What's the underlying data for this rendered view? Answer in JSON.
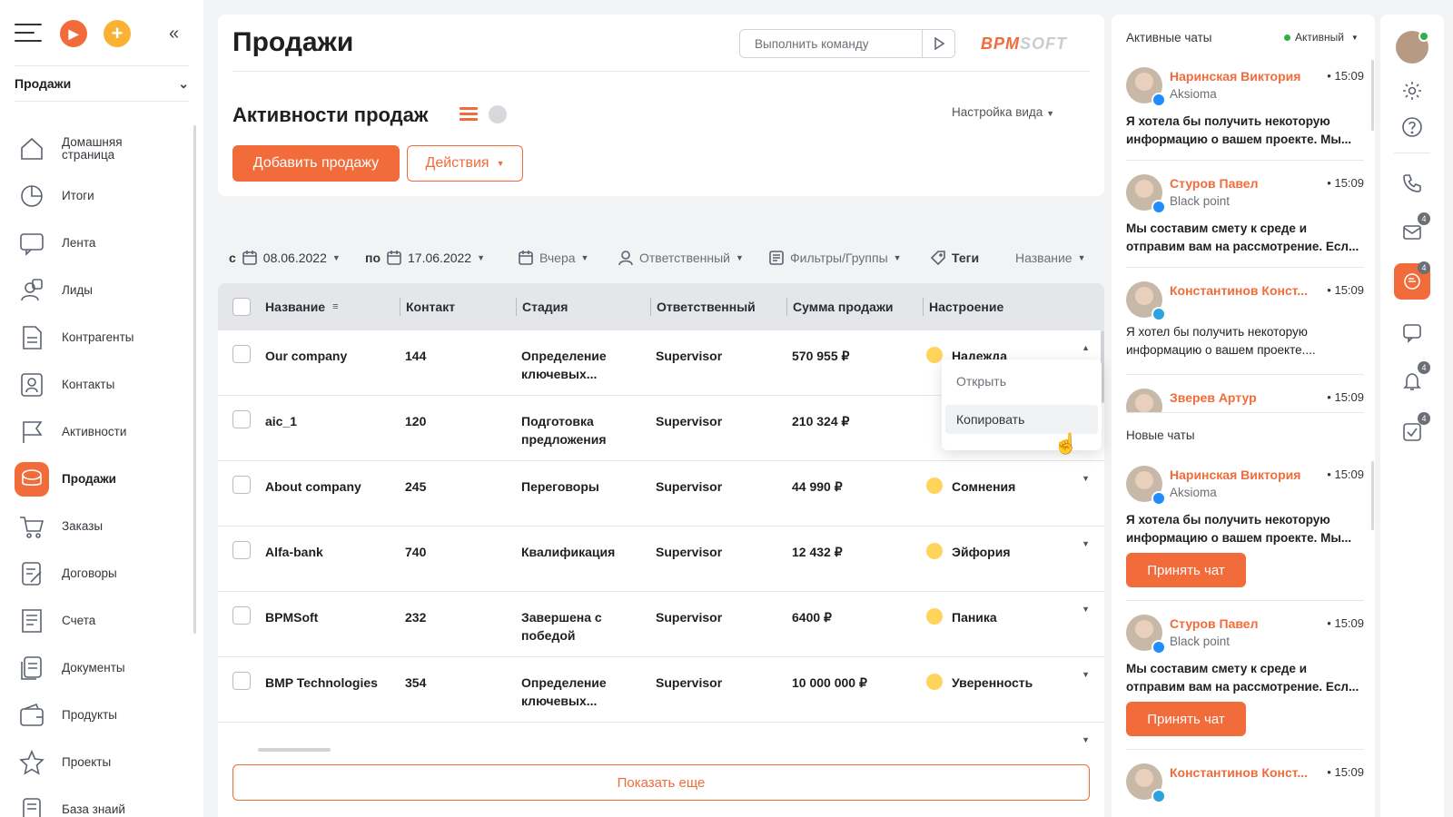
{
  "sidebar": {
    "section": "Продажи",
    "items": [
      {
        "label": "Домашняя страница",
        "icon": "home-icon"
      },
      {
        "label": "Итоги",
        "icon": "pie-chart-icon"
      },
      {
        "label": "Лента",
        "icon": "feed-icon"
      },
      {
        "label": "Лиды",
        "icon": "leads-icon"
      },
      {
        "label": "Контрагенты",
        "icon": "accounts-icon"
      },
      {
        "label": "Контакты",
        "icon": "contacts-icon"
      },
      {
        "label": "Активности",
        "icon": "flag-icon"
      },
      {
        "label": "Продажи",
        "icon": "sales-icon",
        "active": true
      },
      {
        "label": "Заказы",
        "icon": "cart-icon"
      },
      {
        "label": "Договоры",
        "icon": "contract-icon"
      },
      {
        "label": "Счета",
        "icon": "invoice-icon"
      },
      {
        "label": "Документы",
        "icon": "documents-icon"
      },
      {
        "label": "Продукты",
        "icon": "wallet-icon"
      },
      {
        "label": "Проекты",
        "icon": "star-icon"
      },
      {
        "label": "База знаий",
        "icon": "knowledge-icon"
      }
    ]
  },
  "header": {
    "title": "Продажи",
    "command_placeholder": "Выполнить команду",
    "logo": {
      "part1": "BPM",
      "part2": "SOFT"
    },
    "subtitle": "Активности продаж",
    "view_settings": "Настройка вида",
    "add_button": "Добавить продажу",
    "actions_button": "Действия"
  },
  "filters": {
    "from_label": "с",
    "from_date": "08.06.2022",
    "to_label": "по",
    "to_date": "17.06.2022",
    "period": "Вчера",
    "owner": "Ответственный",
    "filters_groups": "Фильтры/Группы",
    "tags": "Теги",
    "sort": "Название"
  },
  "table": {
    "columns": [
      "Название",
      "Контакт",
      "Стадия",
      "Ответственный",
      "Сумма продажи",
      "Настроение"
    ],
    "rows": [
      {
        "name": "Our company",
        "contact": "144",
        "stage": "Определение ключевых...",
        "owner": "Supervisor",
        "amount": "570 955 ₽",
        "mood": "Надежда"
      },
      {
        "name": "aic_1",
        "contact": "120",
        "stage": "Подготовка предложения",
        "owner": "Supervisor",
        "amount": "210 324 ₽",
        "mood": ""
      },
      {
        "name": "About company",
        "contact": "245",
        "stage": "Переговоры",
        "owner": "Supervisor",
        "amount": "44 990 ₽",
        "mood": "Сомнения"
      },
      {
        "name": "Alfa-bank",
        "contact": "740",
        "stage": "Квалификация",
        "owner": "Supervisor",
        "amount": "12 432 ₽",
        "mood": "Эйфория"
      },
      {
        "name": "BPMSoft",
        "contact": "232",
        "stage": "Завершена с победой",
        "owner": "Supervisor",
        "amount": "6400 ₽",
        "mood": "Паника"
      },
      {
        "name": "BMP Technologies",
        "contact": "354",
        "stage": "Определение ключевых...",
        "owner": "Supervisor",
        "amount": "10 000 000 ₽",
        "mood": "Уверенность"
      }
    ],
    "more_button": "Показать еще"
  },
  "context_menu": {
    "open": "Открыть",
    "copy": "Копировать"
  },
  "chat_panel": {
    "title": "Активные чаты",
    "status": "Активный",
    "new_chats_title": "Новые чаты",
    "accept_label": "Принять чат",
    "active_chats": [
      {
        "name": "Наринская Виктория",
        "time": "• 15:09",
        "company": "Aksioma",
        "message": "Я хотела бы получить некоторую информацию о вашем проекте. Мы...",
        "unread": true,
        "channel": "messenger"
      },
      {
        "name": "Стуров Павел",
        "time": "• 15:09",
        "company": "Black point",
        "message": "Мы составим смету к среде и отправим вам на рассмотрение. Есл...",
        "unread": true,
        "channel": "messenger"
      },
      {
        "name": "Константинов Конст...",
        "time": "• 15:09",
        "company": "",
        "message": "Я хотел бы получить некоторую информацию о вашем проекте....",
        "unread": false,
        "channel": "telegram"
      },
      {
        "name": "Зверев Артур",
        "time": "• 15:09",
        "company": "",
        "message": "",
        "unread": false,
        "channel": "messenger"
      }
    ],
    "new_chats": [
      {
        "name": "Наринская Виктория",
        "time": "• 15:09",
        "company": "Aksioma",
        "message": "Я хотела бы получить некоторую информацию о вашем проекте. Мы...",
        "channel": "messenger"
      },
      {
        "name": "Стуров Павел",
        "time": "• 15:09",
        "company": "Black point",
        "message": "Мы составим смету к среде и отправим вам на рассмотрение. Есл...",
        "channel": "messenger"
      },
      {
        "name": "Константинов Конст...",
        "time": "• 15:09",
        "company": "",
        "message": "",
        "channel": "telegram"
      }
    ]
  },
  "rail": {
    "email_badge": "4",
    "chat_badge": "4",
    "bell_badge": "4",
    "tasks_badge": "4"
  },
  "colors": {
    "accent": "#f26b3a",
    "online": "#2bb24c"
  }
}
